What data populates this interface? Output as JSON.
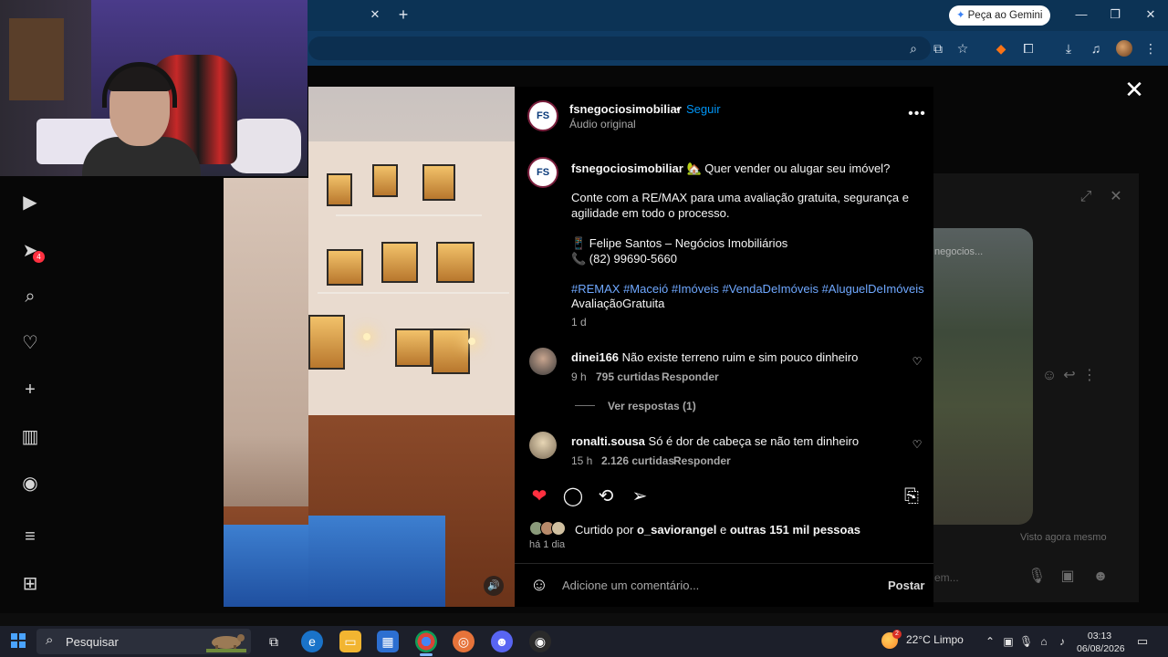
{
  "browser": {
    "gemini_label": "Peça ao Gemini",
    "tab_close": "✕",
    "new_tab": "+"
  },
  "post": {
    "header": {
      "username": "fsnegociosimobiliar",
      "follow": "Seguir",
      "audio": "Áudio original",
      "avatar_text": "FS"
    },
    "caption": {
      "username": "fsnegociosimobiliar",
      "line1": "🏡 Quer vender ou alugar seu imóvel?",
      "line2": "Conte com a RE/MAX para uma avaliação gratuita, segurança e",
      "line3": "agilidade em todo o processo.",
      "contact_name": "📱 Felipe Santos – Negócios Imobiliários",
      "contact_phone": "📞 (82) 99690-5660",
      "hashtags": "#REMAX #Maceió #Imóveis #VendaDeImóveis #AluguelDeImóveis",
      "hashtag_tail": "AvaliaçãoGratuita",
      "time": "1 d"
    },
    "comments": [
      {
        "username": "dinei166",
        "text": "Não existe terreno ruim e sim pouco dinheiro",
        "time": "9 h",
        "likes": "795 curtidas",
        "reply": "Responder",
        "view_replies": "Ver respostas (1)"
      },
      {
        "username": "ronalti.sousa",
        "text": "Só é dor de cabeça se não tem dinheiro",
        "time": "15 h",
        "likes": "2.126 curtidas",
        "reply": "Responder"
      }
    ],
    "likes_prefix": "Curtido por",
    "likes_user": "o_saviorangel",
    "likes_mid": "e",
    "likes_others": "outras 151 mil pessoas",
    "posted": "há 1 dia",
    "comment_placeholder": "Adicione um comentário...",
    "post_button": "Postar"
  },
  "sidebar": {
    "notification_count": "4"
  },
  "chat": {
    "image_label": "negocios...",
    "seen": "Visto agora mesmo",
    "input_placeholder": "em..."
  },
  "taskbar": {
    "search_label": "Pesquisar",
    "weather": "22°C  Limpo",
    "weather_badge": "2",
    "time": "03:13",
    "date": "06/08/2026"
  },
  "colors": {
    "browser_tabstrip": "#0c3355",
    "browser_toolbar": "#0f3a62",
    "instagram_blue": "#0095f6",
    "like_red": "#ff3040",
    "taskbar": "#1c1f2a"
  }
}
